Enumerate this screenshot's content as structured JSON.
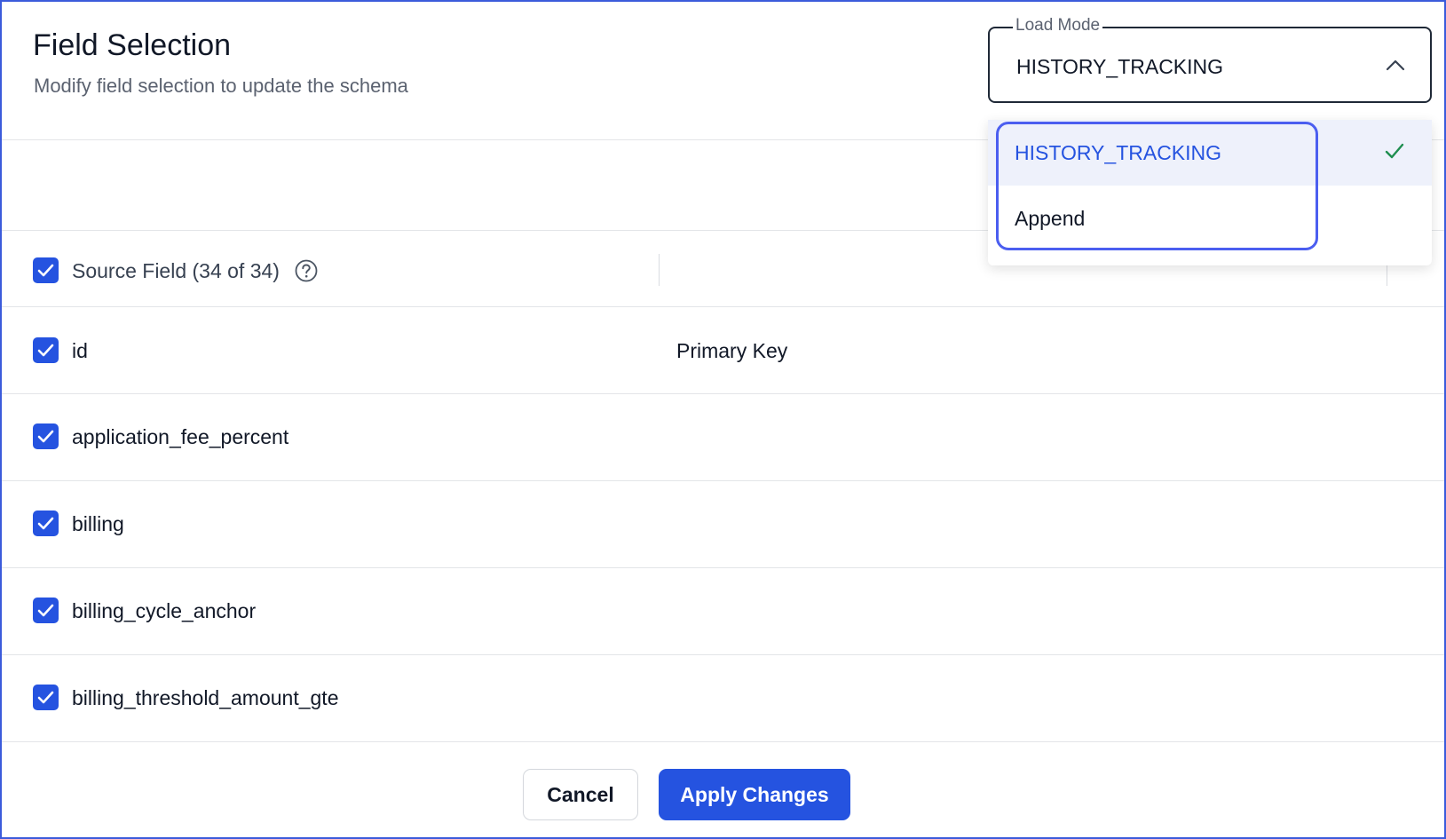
{
  "header": {
    "title": "Field Selection",
    "subtitle": "Modify field selection to update the schema"
  },
  "load_mode": {
    "legend": "Load Mode",
    "value": "HISTORY_TRACKING",
    "options": [
      {
        "label": "HISTORY_TRACKING",
        "selected": true
      },
      {
        "label": "Append",
        "selected": false
      }
    ]
  },
  "table": {
    "header": {
      "label": "Source Field (34 of 34)",
      "checked": true
    },
    "rows": [
      {
        "name": "id",
        "key": "Primary Key",
        "checked": true
      },
      {
        "name": "application_fee_percent",
        "key": "",
        "checked": true
      },
      {
        "name": "billing",
        "key": "",
        "checked": true
      },
      {
        "name": "billing_cycle_anchor",
        "key": "",
        "checked": true
      },
      {
        "name": "billing_threshold_amount_gte",
        "key": "",
        "checked": true
      }
    ]
  },
  "footer": {
    "cancel_label": "Cancel",
    "apply_label": "Apply Changes"
  },
  "colors": {
    "accent": "#2553e0",
    "check": "#1e8e4f",
    "focus_ring": "#4b5ef0"
  }
}
